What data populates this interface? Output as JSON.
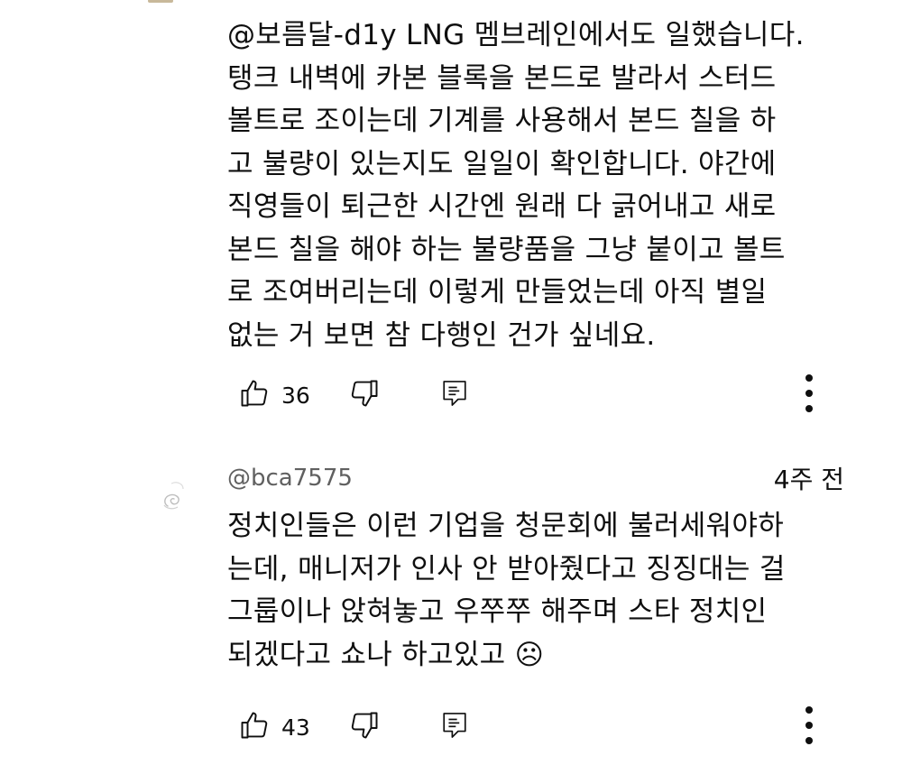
{
  "comments": [
    {
      "author": "",
      "timestamp": "",
      "text_lines": [
        "@보름달-d1y LNG 멤브레인에서도 일했습니다.",
        "탱크 내벽에 카본 블록을 본드로 발라서 스터드",
        "볼트로 조이는데 기계를 사용해서 본드 칠을 하",
        "고 불량이 있는지도 일일이 확인합니다. 야간에",
        "직영들이 퇴근한 시간엔 원래 다 긁어내고 새로",
        "본드 칠을 해야 하는 불량품을 그냥 붙이고 볼트",
        "로 조여버리는데 이렇게 만들었는데 아직 별일",
        "없는 거 보면 참 다행인 건가 싶네요."
      ],
      "like_count": "36"
    },
    {
      "author": "@bca7575",
      "timestamp": "4주 전",
      "text_lines": [
        "정치인들은 이런 기업을 청문회에 불러세워야하",
        "는데, 매니저가 인사 안 받아줬다고 징징대는 걸",
        "그룹이나 앉혀놓고 우쭈쭈 해주며 스타 정치인",
        "되겠다고 쇼나 하고있고 ☹"
      ],
      "like_count": "43"
    }
  ],
  "icons": {
    "like": "thumb-up-icon",
    "dislike": "thumb-down-icon",
    "reply": "reply-icon",
    "more": "more-vert-icon"
  },
  "colors": {
    "text": "#0f0f0f",
    "secondary": "#606060",
    "icon": "#0f0f0f"
  }
}
